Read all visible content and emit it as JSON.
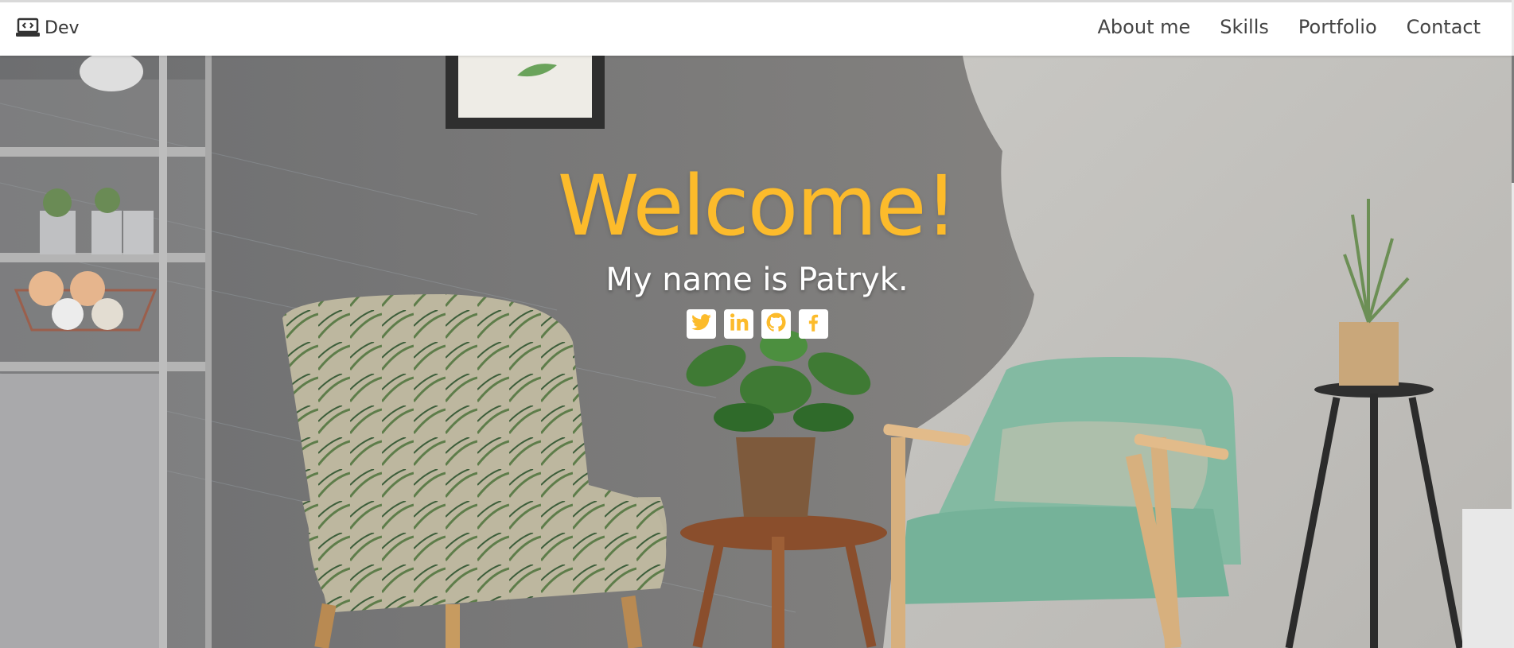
{
  "nav": {
    "brand_label": "Dev",
    "brand_icon": "laptop-code-icon",
    "links": [
      {
        "label": "About me"
      },
      {
        "label": "Skills"
      },
      {
        "label": "Portfolio"
      },
      {
        "label": "Contact"
      }
    ]
  },
  "hero": {
    "title": "Welcome!",
    "subtitle": "My name is Patryk.",
    "title_color": "#fcbb2b",
    "social_icons": [
      "twitter-icon",
      "linkedin-icon",
      "github-icon",
      "facebook-icon"
    ],
    "background": "living-room-photo"
  }
}
